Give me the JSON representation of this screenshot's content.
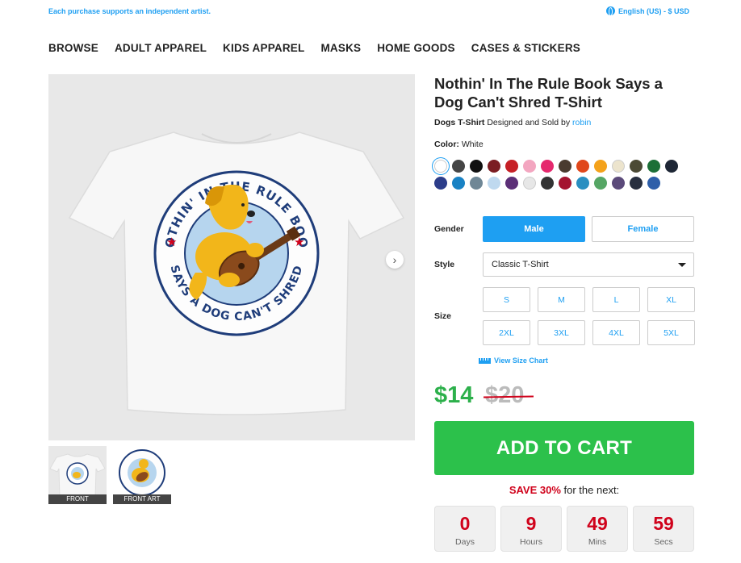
{
  "topbar": {
    "promo": "Each purchase supports an independent artist.",
    "locale": "English (US) - $ USD"
  },
  "nav": [
    "BROWSE",
    "ADULT APPAREL",
    "KIDS APPAREL",
    "MASKS",
    "HOME GOODS",
    "CASES & STICKERS"
  ],
  "product": {
    "title": "Nothin' In The Rule Book Says a Dog Can't Shred T-Shirt",
    "category": "Dogs T-Shirt",
    "designed_by_text": "Designed and Sold by",
    "artist": "robin",
    "color_label": "Color:",
    "color_value": "White",
    "art_text_top": "NOTHIN' IN THE RULE BOOK",
    "art_text_bottom": "SAYS A DOG CAN'T SHRED"
  },
  "swatches": [
    "#ffffff",
    "#454545",
    "#111111",
    "#7b1d23",
    "#c62026",
    "#f3a6c0",
    "#e5296e",
    "#4a3b2f",
    "#e0471b",
    "#f4a21b",
    "#ece4cd",
    "#4b4a35",
    "#1c6f37",
    "#1d2635",
    "#2c3d8a",
    "#1982c4",
    "#6f8796",
    "#bfd9ef",
    "#5c2f77",
    "#e7e7e7",
    "#333333",
    "#a4142f",
    "#2a8fc1",
    "#56a665",
    "#5b4a7a",
    "#272f3f",
    "#2e5fa9"
  ],
  "gallery": {
    "thumbs": [
      "FRONT",
      "FRONT ART"
    ]
  },
  "options": {
    "gender_label": "Gender",
    "gender": [
      "Male",
      "Female"
    ],
    "style_label": "Style",
    "style_value": "Classic T-Shirt",
    "size_label": "Size",
    "sizes": [
      "S",
      "M",
      "L",
      "XL",
      "2XL",
      "3XL",
      "4XL",
      "5XL"
    ],
    "size_chart": "View Size Chart"
  },
  "pricing": {
    "price": "$14",
    "old_price": "$20",
    "cart": "ADD TO CART",
    "save": "SAVE 30%",
    "save_suffix": "for the next:"
  },
  "countdown": [
    {
      "num": "0",
      "unit": "Days"
    },
    {
      "num": "9",
      "unit": "Hours"
    },
    {
      "num": "49",
      "unit": "Mins"
    },
    {
      "num": "59",
      "unit": "Secs"
    }
  ]
}
